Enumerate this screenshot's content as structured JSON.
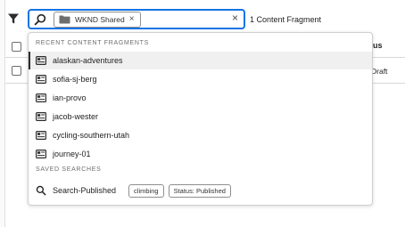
{
  "search": {
    "tag_label": "WKND Shared",
    "tag_remove": "×",
    "clear": "×"
  },
  "result_count": "1 Content Fragment",
  "table": {
    "status_header_partial": "us",
    "row_status_partial": "Draft"
  },
  "dropdown": {
    "recent_heading": "RECENT CONTENT FRAGMENTS",
    "recent_items": [
      {
        "label": "alaskan-adventures"
      },
      {
        "label": "sofia-sj-berg"
      },
      {
        "label": "ian-provo"
      },
      {
        "label": "jacob-wester"
      },
      {
        "label": "cycling-southern-utah"
      },
      {
        "label": "journey-01"
      }
    ],
    "saved_heading": "SAVED SEARCHES",
    "saved_searches": [
      {
        "label": "Search-Published",
        "tags": [
          "climbing",
          "Status: Published"
        ]
      }
    ]
  },
  "icons": {
    "filter": "filter-icon",
    "search": "search-icon",
    "folder": "folder-icon",
    "fragment": "content-fragment-icon"
  },
  "colors": {
    "focus_border": "#1473e6",
    "active_row": "#f0f0f0"
  }
}
